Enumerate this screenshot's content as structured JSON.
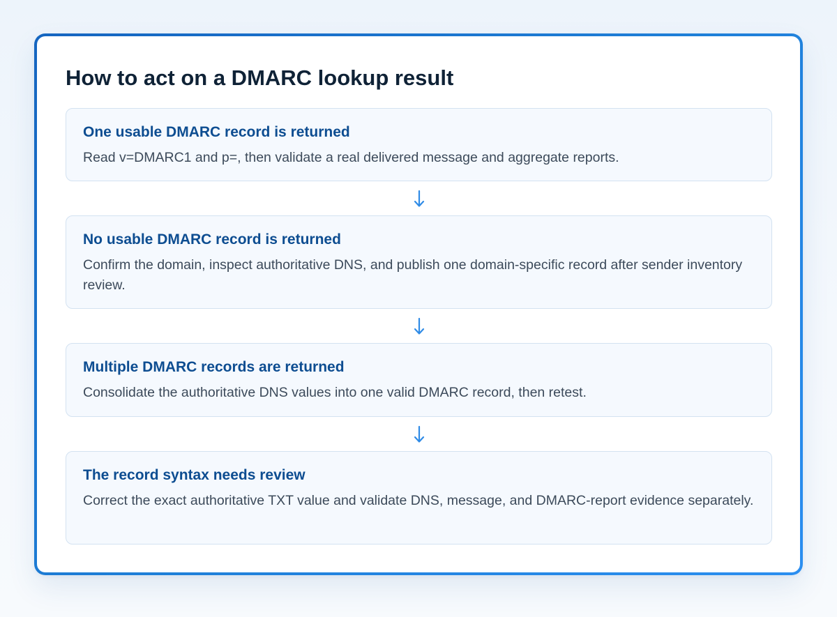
{
  "title": "How to act on a DMARC lookup result",
  "colors": {
    "accent": "#1e7fd8",
    "heading": "#0d4d91",
    "arrow": "#2f8be6"
  },
  "steps": [
    {
      "heading": "One usable DMARC record is returned",
      "text": "Read v=DMARC1 and p=, then validate a real delivered message and aggregate reports."
    },
    {
      "heading": "No usable DMARC record is returned",
      "text": "Confirm the domain, inspect authoritative DNS, and publish one domain-specific record after sender inventory review."
    },
    {
      "heading": "Multiple DMARC records are returned",
      "text": "Consolidate the authoritative DNS values into one valid DMARC record, then retest."
    },
    {
      "heading": "The record syntax needs review",
      "text": "Correct the exact authoritative TXT value and validate DNS, message, and DMARC-report evidence separately."
    }
  ],
  "connector_icon": "arrow-down-icon"
}
